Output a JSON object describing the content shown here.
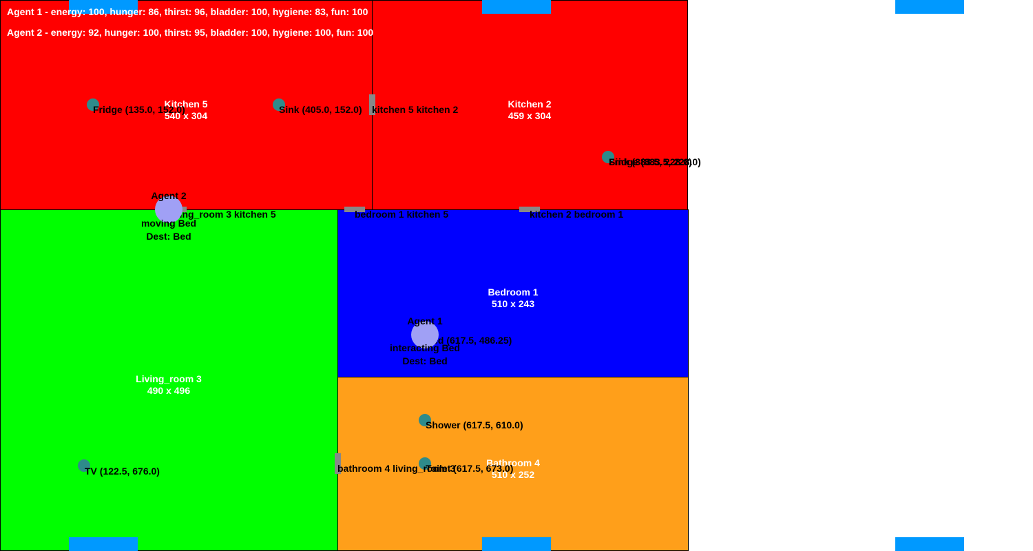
{
  "stats": {
    "agent1": "Agent 1 - energy: 100, hunger: 86, thirst: 96, bladder: 100, hygiene: 83, fun: 100",
    "agent2": "Agent 2 - energy: 92, hunger: 100, thirst: 95, bladder: 100, hygiene: 100, fun: 100"
  },
  "rooms": {
    "kitchen5": {
      "name": "Kitchen 5",
      "size": "540 x 304",
      "color": "#ff0000"
    },
    "kitchen2": {
      "name": "Kitchen 2",
      "size": "459 x 304",
      "color": "#ff0000"
    },
    "living3": {
      "name": "Living_room 3",
      "size": "490 x 496",
      "color": "#00ff00"
    },
    "bedroom1": {
      "name": "Bedroom 1",
      "size": "510 x 243",
      "color": "#0000ff"
    },
    "bathroom4": {
      "name": "Bathroom 4",
      "size": "510 x 252",
      "color": "#ff9f1a"
    }
  },
  "objects": {
    "fridge5": "Fridge (135.0, 152.0)",
    "sink5": "Sink (405.0, 152.0)",
    "sink2": "Sink (883.5, 228.0)",
    "fridge2": "Fridge (883.5, 228.0)",
    "tv": "TV (122.5, 676.0)",
    "bed": "Bed (617.5, 486.25)",
    "shower": "Shower (617.5, 610.0)",
    "toilet": "Toilet (617.5, 673.0)"
  },
  "doors": {
    "k5k2": "kitchen 5 kitchen 2",
    "lk5": "living_room 3 kitchen 5",
    "bk5": "bedroom 1 kitchen 5",
    "k2b1": "kitchen 2 bedroom 1",
    "bath_living": "bathroom 4 living_room 3"
  },
  "agents": {
    "agent1": {
      "name": "Agent 1",
      "state": "interacting Bed",
      "dest": "Dest: Bed"
    },
    "agent2": {
      "name": "Agent 2",
      "state": "moving Bed",
      "dest": "Dest: Bed"
    }
  }
}
